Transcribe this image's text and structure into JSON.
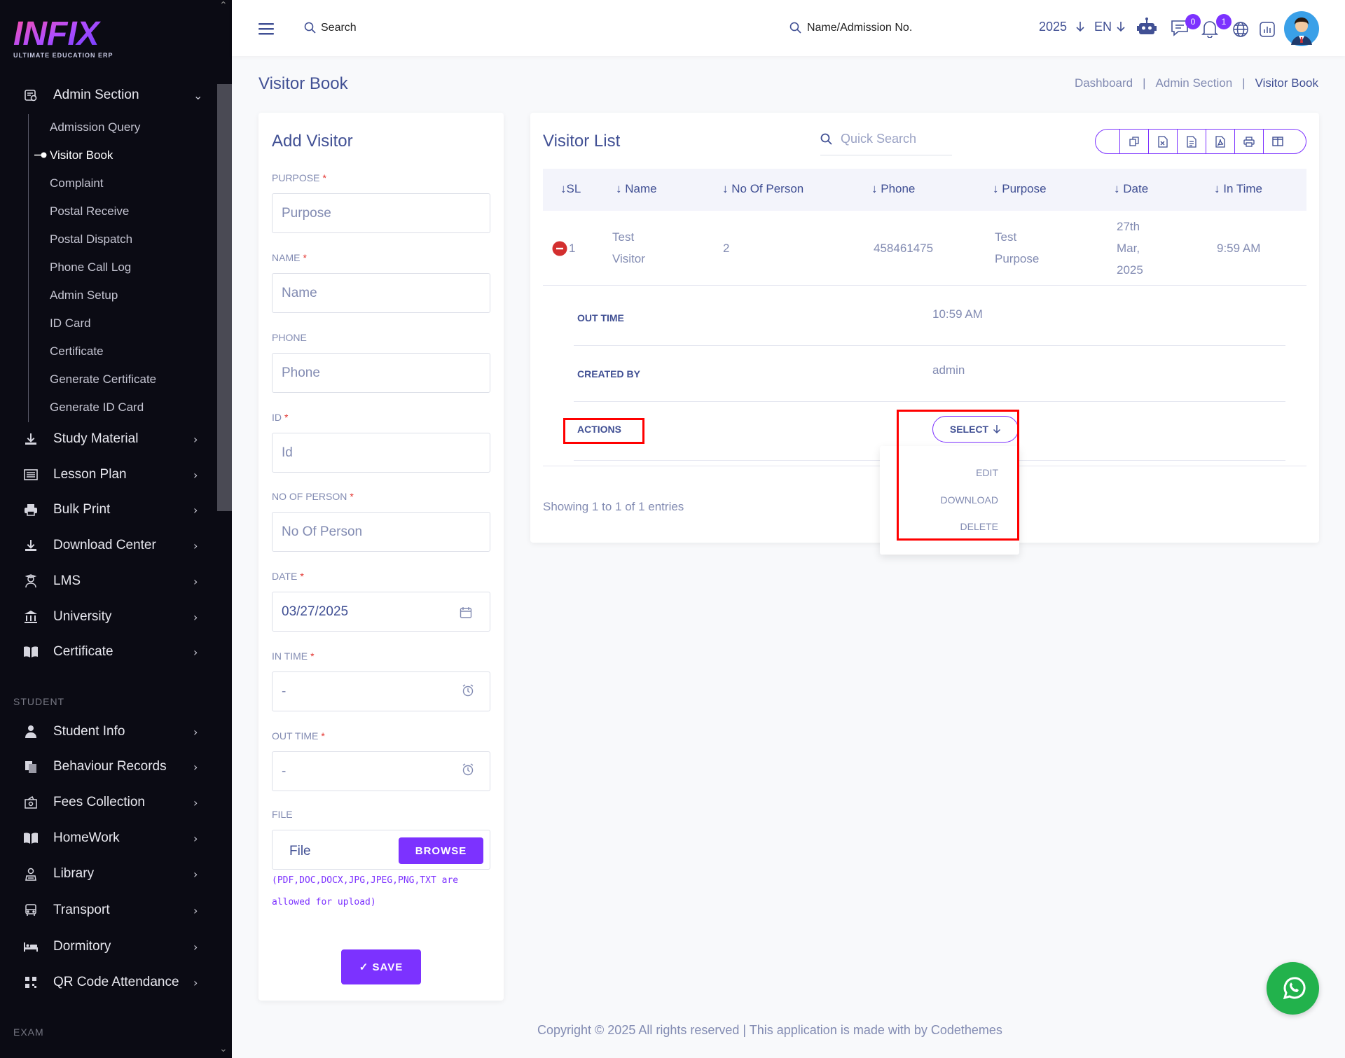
{
  "brand": {
    "logo_text": "INFIX",
    "tagline": "ULTIMATE EDUCATION ERP"
  },
  "sidebar": {
    "admin_section": "Admin Section",
    "sub_items": [
      "Admission Query",
      "Visitor Book",
      "Complaint",
      "Postal Receive",
      "Postal Dispatch",
      "Phone Call Log",
      "Admin Setup",
      "ID Card",
      "Certificate",
      "Generate Certificate",
      "Generate ID Card"
    ],
    "active_sub": "Visitor Book",
    "items": [
      {
        "label": "Study Material",
        "icon": "download-icon"
      },
      {
        "label": "Lesson Plan",
        "icon": "list-icon"
      },
      {
        "label": "Bulk Print",
        "icon": "print-icon"
      },
      {
        "label": "Download Center",
        "icon": "download-icon"
      },
      {
        "label": "LMS",
        "icon": "user-graduate-icon"
      },
      {
        "label": "University",
        "icon": "university-icon"
      },
      {
        "label": "Certificate",
        "icon": "book-icon"
      }
    ],
    "student_heading": "STUDENT",
    "student_items": [
      {
        "label": "Student Info",
        "icon": "user-icon"
      },
      {
        "label": "Behaviour Records",
        "icon": "copy-icon"
      },
      {
        "label": "Fees Collection",
        "icon": "money-icon"
      },
      {
        "label": "HomeWork",
        "icon": "book-icon"
      },
      {
        "label": "Library",
        "icon": "library-icon"
      },
      {
        "label": "Transport",
        "icon": "bus-icon"
      },
      {
        "label": "Dormitory",
        "icon": "bed-icon"
      },
      {
        "label": "QR Code Attendance",
        "icon": "qr-icon"
      }
    ],
    "exam_heading": "EXAM"
  },
  "header": {
    "search_label": "Search",
    "student_search_label": "Name/Admission No.",
    "year": "2025",
    "language": "EN",
    "messages_count": "0",
    "notifications_count": "1"
  },
  "page": {
    "title": "Visitor Book",
    "breadcrumb": [
      "Dashboard",
      "Admin Section",
      "Visitor Book"
    ],
    "separator": "|"
  },
  "add_visitor": {
    "title": "Add Visitor",
    "purpose_label": "PURPOSE",
    "purpose_placeholder": "Purpose",
    "name_label": "NAME",
    "name_placeholder": "Name",
    "phone_label": "PHONE",
    "phone_placeholder": "Phone",
    "id_label": "ID",
    "id_placeholder": "Id",
    "no_person_label": "NO OF PERSON",
    "no_person_placeholder": "No Of Person",
    "date_label": "DATE",
    "date_value": "03/27/2025",
    "in_time_label": "IN TIME",
    "in_time_value": "-",
    "out_time_label": "OUT TIME",
    "out_time_value": "-",
    "file_label": "FILE",
    "file_placeholder": "File",
    "browse_label": "BROWSE",
    "file_note_1": "(PDF,DOC,DOCX,JPG,JPEG,PNG,TXT are",
    "file_note_2": "allowed for upload)",
    "save_label": "SAVE",
    "required_mark": "*"
  },
  "visitor_list": {
    "title": "Visitor List",
    "quick_search_placeholder": "Quick Search",
    "columns": [
      "SL",
      "Name",
      "No Of Person",
      "Phone",
      "Purpose",
      "Date",
      "In Time"
    ],
    "row": {
      "sl": "1",
      "name_1": "Test",
      "name_2": "Visitor",
      "no_of_person": "2",
      "phone": "458461475",
      "purpose_1": "Test",
      "purpose_2": "Purpose",
      "date_1": "27th",
      "date_2": "Mar,",
      "date_3": "2025",
      "in_time": "9:59 AM"
    },
    "details": {
      "out_time_label": "OUT TIME",
      "out_time_value": "10:59 AM",
      "created_by_label": "CREATED BY",
      "created_by_value": "admin",
      "actions_label": "ACTIONS"
    },
    "select_label": "SELECT",
    "actions_menu": [
      "EDIT",
      "DOWNLOAD",
      "DELETE"
    ],
    "showing": "Showing 1 to 1 of 1 entries"
  },
  "footer": {
    "text": "Copyright © 2025 All rights reserved | This application is made with by Codethemes"
  },
  "colors": {
    "accent": "#7c32ff",
    "text": "#415094",
    "muted": "#828bb2",
    "sidebar": "#0b0b14",
    "highlight": "#ff0000",
    "whatsapp": "#22b24c"
  }
}
